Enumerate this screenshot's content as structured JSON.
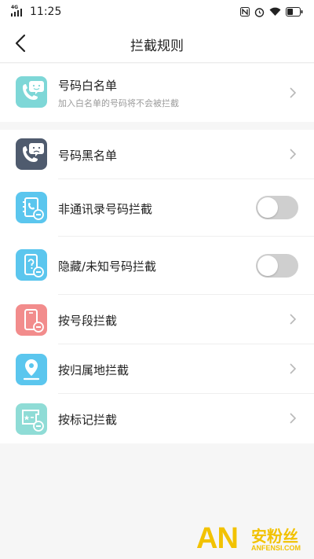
{
  "status_bar": {
    "network": "4G",
    "time": "11:25"
  },
  "nav": {
    "title": "拦截规则"
  },
  "whitelist": {
    "title": "号码白名单",
    "subtitle": "加入白名单的号码将不会被拦截"
  },
  "rules": [
    {
      "title": "号码黑名单"
    },
    {
      "title": "非通讯录号码拦截",
      "toggle_on": false
    },
    {
      "title": "隐藏/未知号码拦截",
      "toggle_on": false
    },
    {
      "title": "按号段拦截"
    },
    {
      "title": "按归属地拦截"
    },
    {
      "title": "按标记拦截"
    }
  ],
  "watermark": {
    "logo_text": "AN",
    "cn_text": "安粉丝",
    "url_text": "ANFENSI.COM"
  },
  "colors": {
    "whitelist_icon": "#7ed7d7",
    "blacklist_icon": "#4f5b6e",
    "contacts_icon": "#5bc6ee",
    "hidden_icon": "#5bc6ee",
    "segment_icon": "#f28c8c",
    "location_icon": "#5bc6ee",
    "mark_icon": "#8fdcd6",
    "toggle_off": "#cfcfcf",
    "watermark": "#f2c200"
  }
}
